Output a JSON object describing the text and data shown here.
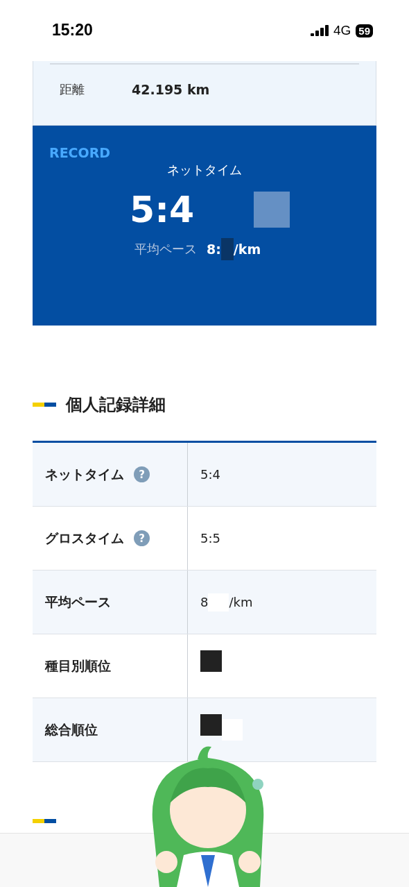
{
  "status_bar": {
    "time": "15:20",
    "network": "4G",
    "battery": "59"
  },
  "distance": {
    "label": "距離",
    "value": "42.195 km"
  },
  "record": {
    "badge": "RECORD",
    "label": "ネットタイム",
    "time": "5:4",
    "pace_label": "平均ペース",
    "pace_value": "8:",
    "pace_unit": "/km"
  },
  "section": {
    "title": "個人記録詳細"
  },
  "rows": [
    {
      "label": "ネットタイム",
      "help": "?",
      "value": "5:4",
      "redacted": false
    },
    {
      "label": "グロスタイム",
      "help": "?",
      "value": "5:5",
      "redacted": false
    },
    {
      "label": "平均ペース",
      "value": "8",
      "unit": "/km",
      "redacted": false
    },
    {
      "label": "種目別順位",
      "redacted": true
    },
    {
      "label": "総合順位",
      "redacted": true
    }
  ]
}
